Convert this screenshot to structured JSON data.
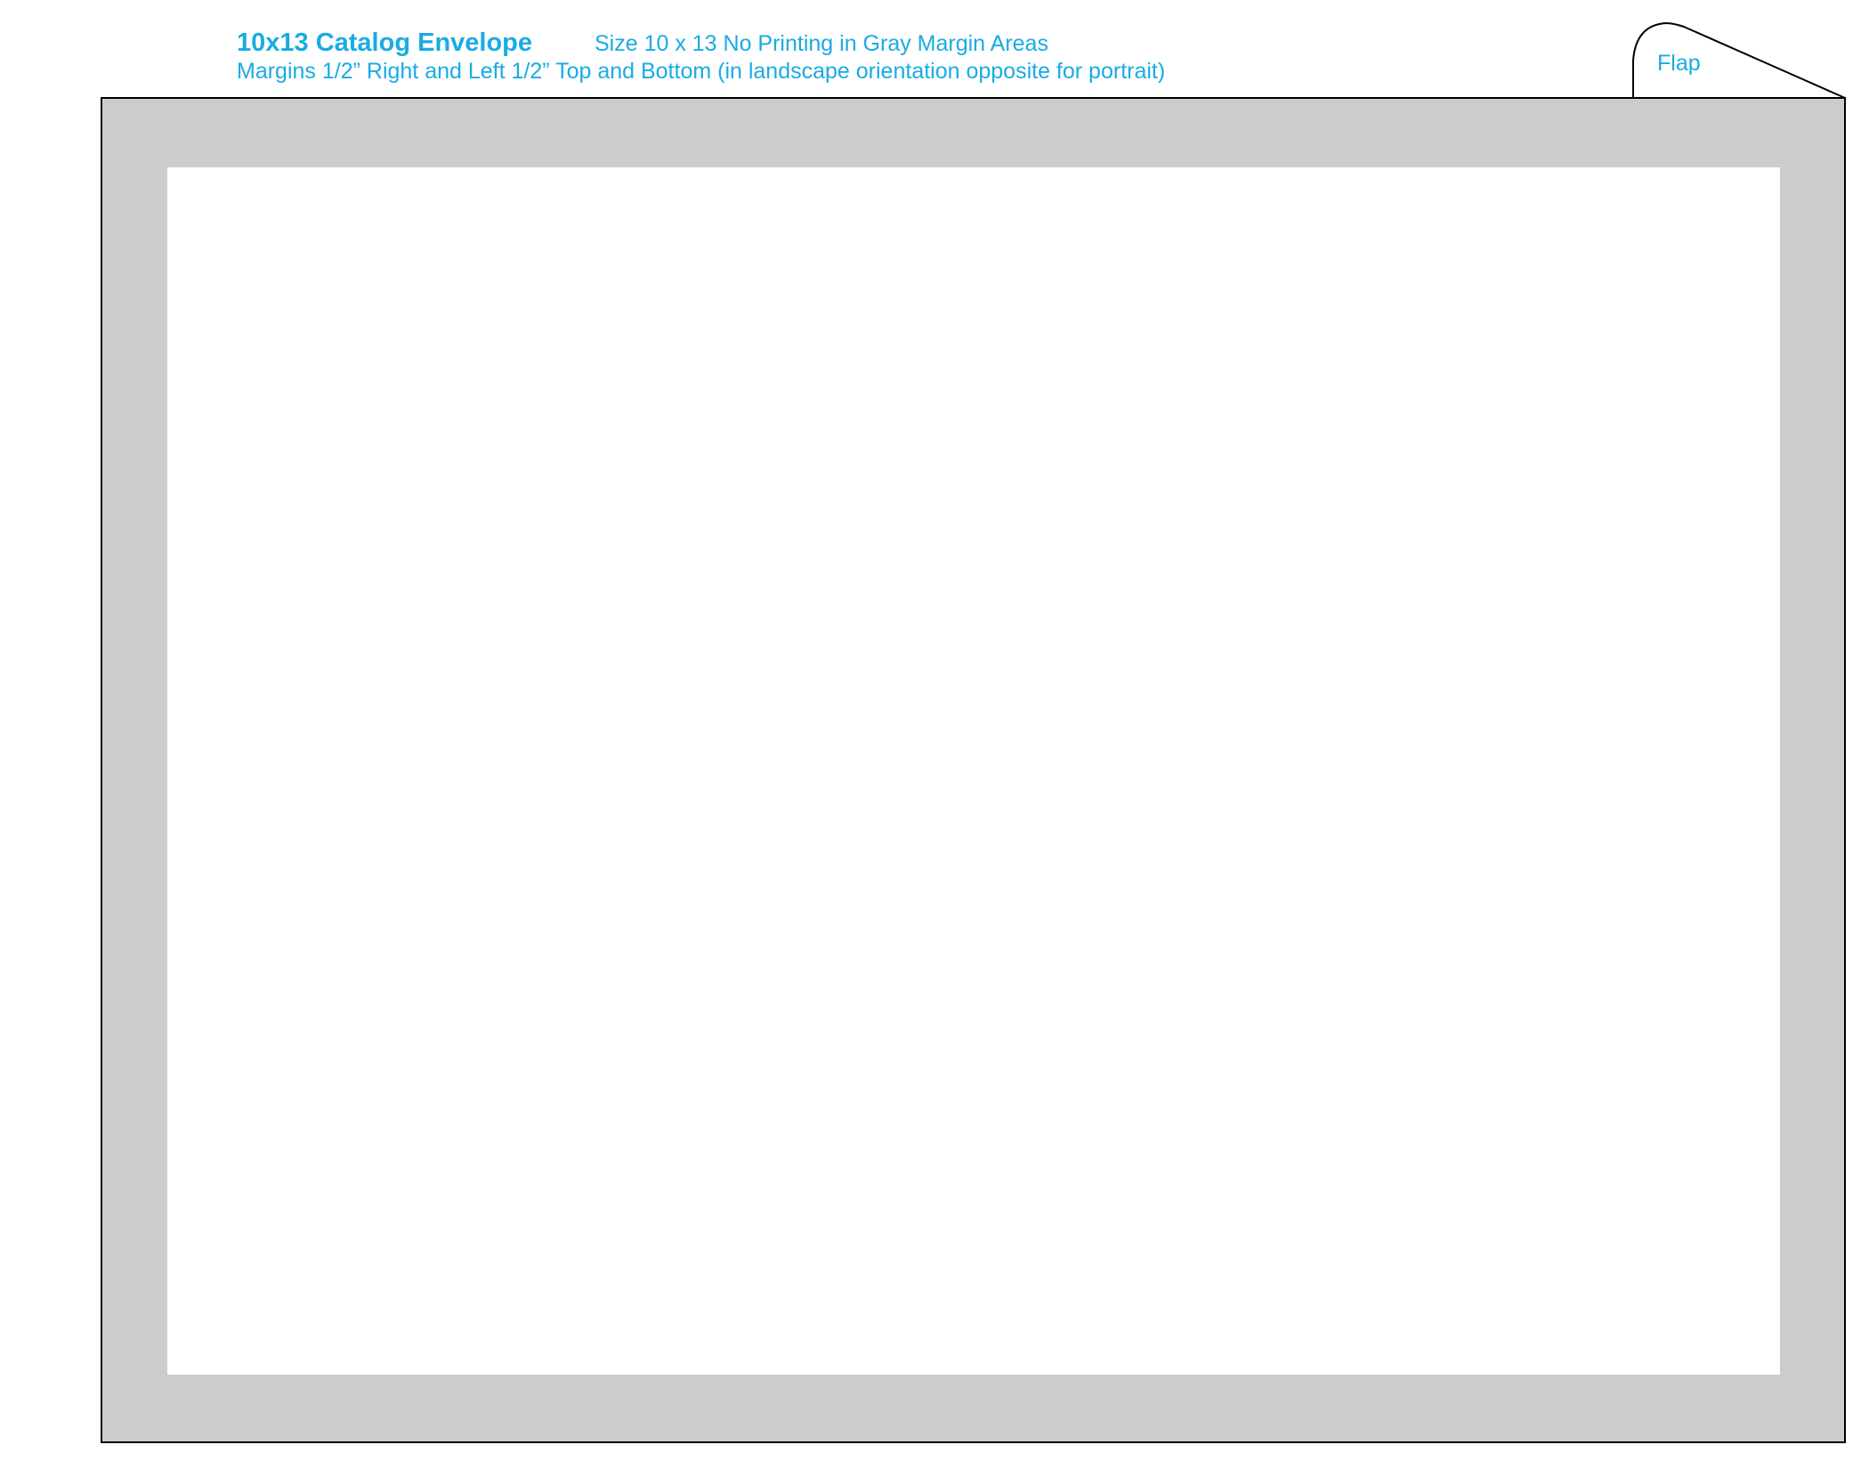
{
  "header": {
    "title": "10x13 Catalog Envelope",
    "size_note": "Size 10 x 13 No Printing in Gray Margin Areas",
    "margins_note": "Margins 1/2” Right and Left  1/2” Top and Bottom (in landscape orientation opposite for portrait)"
  },
  "envelope": {
    "flap_label": "Flap",
    "margin_color": "#cccccc",
    "print_area_color": "#ffffff",
    "outline_color": "#000000",
    "text_color": "#1aabe3"
  }
}
